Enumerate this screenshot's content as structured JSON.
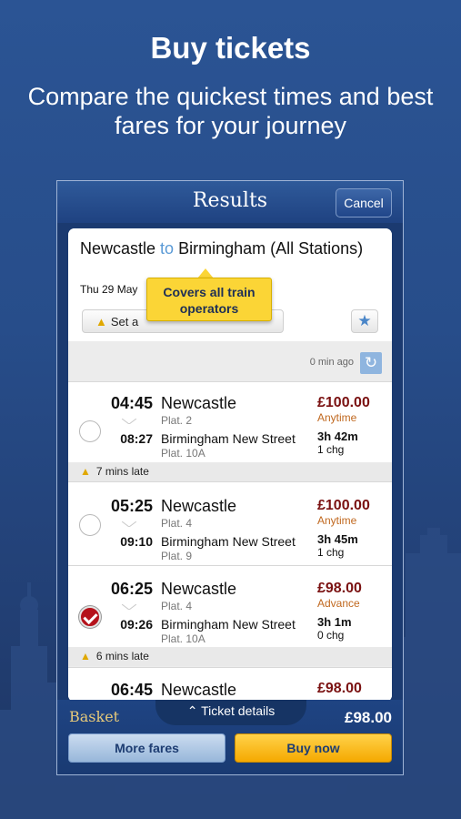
{
  "promo": {
    "title": "Buy tickets",
    "subtitle": "Compare the quickest times and best fares for your journey"
  },
  "header": {
    "title": "Results",
    "cancel_label": "Cancel"
  },
  "journey": {
    "from": "Newcastle",
    "connector": "to",
    "to": "Birmingham (All Stations)",
    "date": "Thu 29 May",
    "alert_label": "Set a",
    "tooltip": "Covers all train operators",
    "favourite_icon": "star-icon"
  },
  "refresh": {
    "updated": "0 min ago",
    "icon": "refresh-icon"
  },
  "results": [
    {
      "dep_time": "04:45",
      "dep_station": "Newcastle",
      "dep_plat": "Plat. 2",
      "arr_time": "08:27",
      "arr_station": "Birmingham New Street",
      "arr_plat": "Plat. 10A",
      "price": "£100.00",
      "fare_type": "Anytime",
      "duration": "3h 42m",
      "changes": "1 chg",
      "selected": false,
      "late": "7 mins late"
    },
    {
      "dep_time": "05:25",
      "dep_station": "Newcastle",
      "dep_plat": "Plat. 4",
      "arr_time": "09:10",
      "arr_station": "Birmingham New Street",
      "arr_plat": "Plat. 9",
      "price": "£100.00",
      "fare_type": "Anytime",
      "duration": "3h 45m",
      "changes": "1 chg",
      "selected": false,
      "late": ""
    },
    {
      "dep_time": "06:25",
      "dep_station": "Newcastle",
      "dep_plat": "Plat. 4",
      "arr_time": "09:26",
      "arr_station": "Birmingham New Street",
      "arr_plat": "Plat. 10A",
      "price": "£98.00",
      "fare_type": "Advance",
      "duration": "3h 1m",
      "changes": "0 chg",
      "selected": true,
      "late": "6 mins late"
    },
    {
      "dep_time": "06:45",
      "dep_station": "Newcastle",
      "price": "£98.00"
    }
  ],
  "footer": {
    "basket_label": "Basket",
    "ticket_details": "Ticket details",
    "total": "£98.00",
    "more_fares": "More fares",
    "buy_now": "Buy now"
  },
  "colors": {
    "accent": "#fbd536",
    "price": "#7a1111",
    "background": "#274d8a"
  }
}
